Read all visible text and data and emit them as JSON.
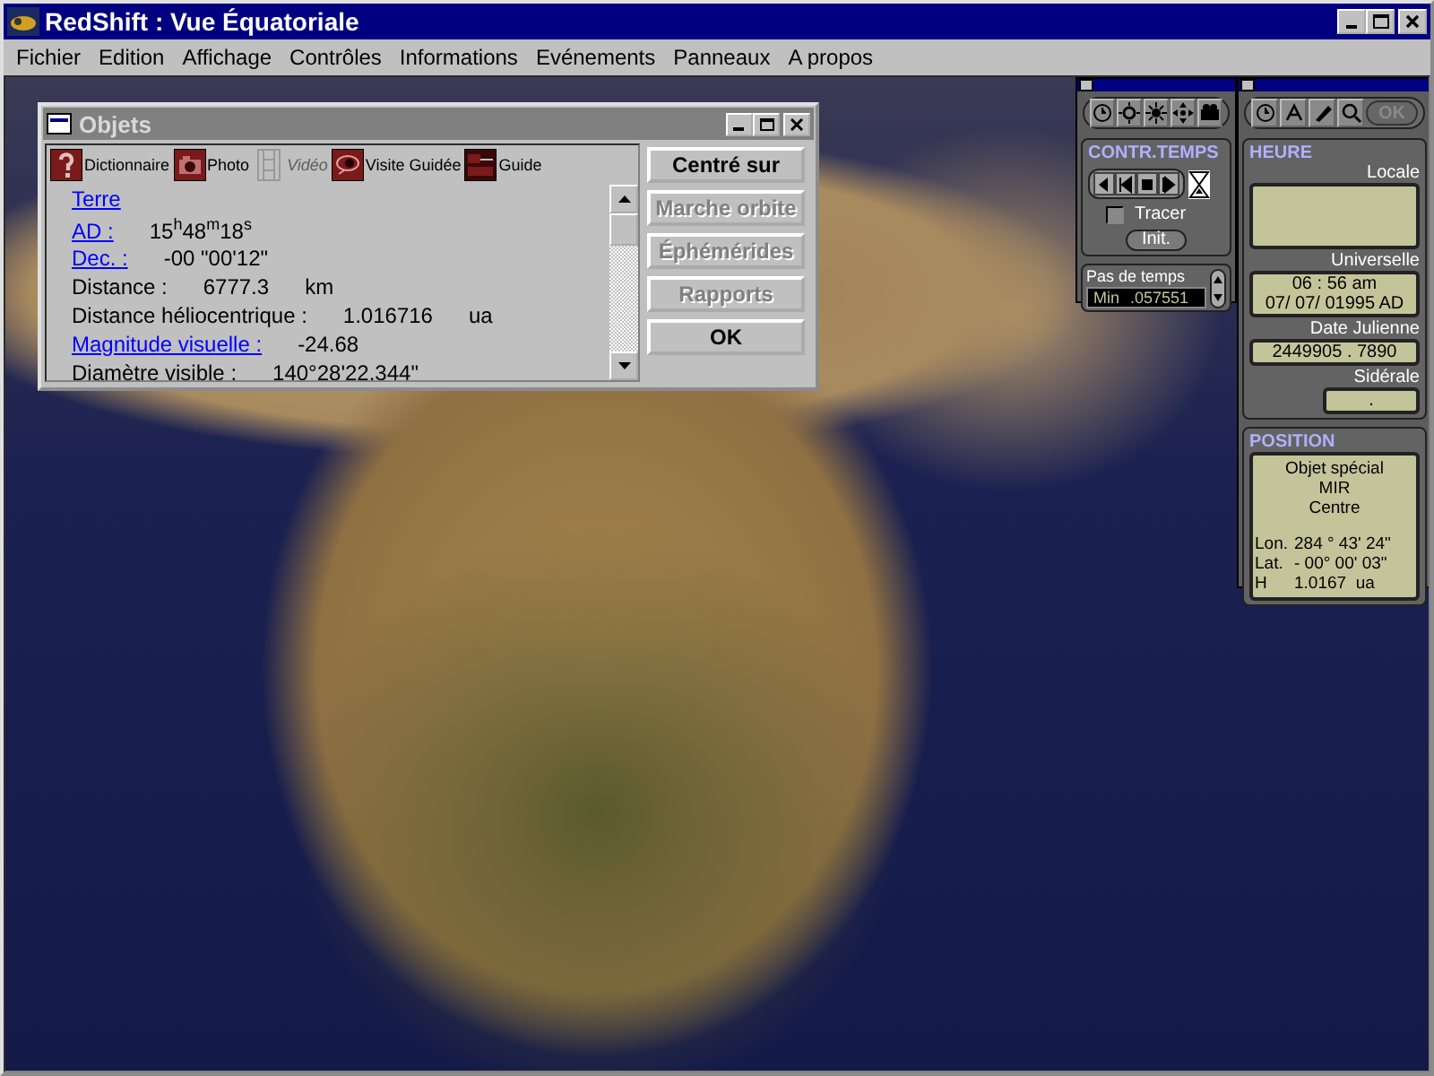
{
  "window": {
    "title": "RedShift : Vue Équatoriale"
  },
  "menu": [
    "Fichier",
    "Edition",
    "Affichage",
    "Contrôles",
    "Informations",
    "Evénements",
    "Panneaux",
    "A propos"
  ],
  "objects_window": {
    "title": "Objets",
    "toolbar": [
      {
        "kind": "dictionary",
        "label": "Dictionnaire",
        "disabled": false
      },
      {
        "kind": "camera",
        "label": "Photo",
        "disabled": false
      },
      {
        "kind": "film",
        "label": "Vidéo",
        "disabled": true
      },
      {
        "kind": "tour",
        "label": "Visite Guidée",
        "disabled": false
      },
      {
        "kind": "guide",
        "label": "Guide",
        "disabled": false
      }
    ],
    "rows": [
      {
        "kind": "title",
        "label": "Terre"
      },
      {
        "kind": "link",
        "label": "AD :",
        "value": "15$^{h}$48$^{m}$18$^{s}$"
      },
      {
        "kind": "link",
        "label": "Dec. :",
        "value": "-00 \"00'12\""
      },
      {
        "kind": "data",
        "label": "Distance :",
        "value": "6777.3",
        "unit": "km"
      },
      {
        "kind": "data",
        "label": "Distance héliocentrique :",
        "value": "1.016716",
        "unit": "ua"
      },
      {
        "kind": "link",
        "label": "Magnitude visuelle :",
        "value": "-24.68"
      },
      {
        "kind": "data",
        "label": "Diamètre visible :",
        "value": "140°28'22.344\""
      }
    ],
    "buttons": [
      {
        "label": "Centré sur",
        "disabled": false
      },
      {
        "label": "Marche orbite",
        "disabled": true
      },
      {
        "label": "Éphémérides",
        "disabled": true
      },
      {
        "label": "Rapports",
        "disabled": true
      },
      {
        "label": "OK",
        "disabled": false
      }
    ]
  },
  "time_panel": {
    "title": "CONTR.TEMPS",
    "tracer": {
      "label": "Tracer",
      "checked": false
    },
    "init_button": "Init.",
    "step_label": "Pas de temps",
    "step_unit": "Min",
    "step_value": ".057551"
  },
  "clock_panel": {
    "ok_button": "OK",
    "title": "HEURE",
    "local_label": "Locale",
    "universal_label": "Universelle",
    "universal_time": "06 : 56 am",
    "universal_date": "07/ 07/ 01995 AD",
    "julian_label": "Date Julienne",
    "julian_value": "2449905 . 7890",
    "sidereal_label": "Sidérale",
    "sidereal_value": "."
  },
  "position_panel": {
    "title": "POSITION",
    "lines": [
      "Objet spécial",
      "MIR",
      "Centre"
    ],
    "coords": [
      {
        "label": "Lon.",
        "value": "284 ° 43' 24\""
      },
      {
        "label": "Lat.",
        "value": "- 00° 00' 03\""
      },
      {
        "label": "H",
        "value": "1.0167  ua"
      }
    ]
  }
}
